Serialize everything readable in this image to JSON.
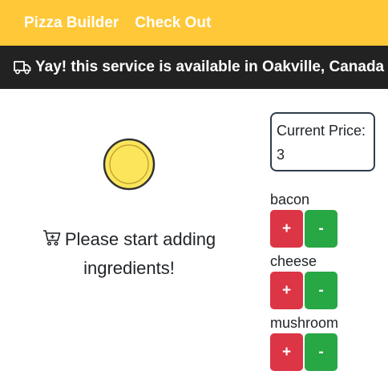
{
  "navbar": {
    "links": [
      {
        "label": "Pizza Builder"
      },
      {
        "label": "Check Out"
      }
    ],
    "bg_color": "#ffc838"
  },
  "banner": {
    "icon": "truck-icon",
    "text": "Yay! this service is available in Oakville, Canada"
  },
  "pizza": {
    "icon": "pizza-base-icon",
    "fill_color": "#fbe55a"
  },
  "empty_state": {
    "icon": "cart-icon",
    "message": "Please start adding ingredients!"
  },
  "price": {
    "label": "Current Price: 3"
  },
  "ingredients": [
    {
      "name": "bacon",
      "add_label": "+",
      "remove_label": "-"
    },
    {
      "name": "cheese",
      "add_label": "+",
      "remove_label": "-"
    },
    {
      "name": "mushroom",
      "add_label": "+",
      "remove_label": "-"
    }
  ],
  "colors": {
    "add_button": "#dc3545",
    "remove_button": "#28a745",
    "banner_bg": "#222222"
  }
}
